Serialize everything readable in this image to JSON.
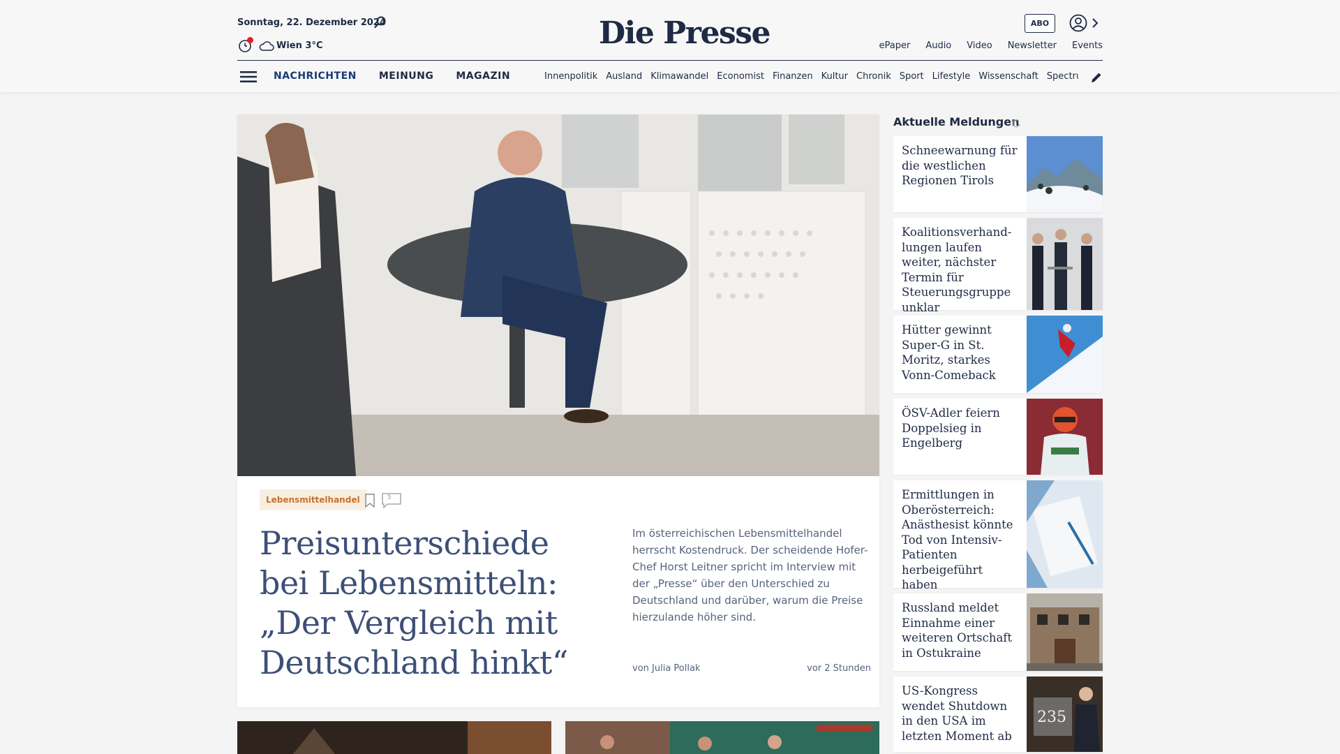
{
  "header": {
    "date": "Sonntag, 22. Dezember 2024",
    "weather": "Wien 3°C",
    "logo": "Die Presse",
    "abo_label": "ABO",
    "top_links": [
      "ePaper",
      "Audio",
      "Video",
      "Newsletter",
      "Events"
    ],
    "main_nav": [
      "NACHRICHTEN",
      "MEINUNG",
      "MAGAZIN"
    ],
    "sub_nav": [
      "Innenpolitik",
      "Ausland",
      "Klimawandel",
      "Economist",
      "Finanzen",
      "Kultur",
      "Chronik",
      "Sport",
      "Lifestyle",
      "Wissenschaft",
      "Spectrum"
    ]
  },
  "hero": {
    "tag": "Lebensmittelhandel",
    "comment_count": "5",
    "headline": "Preisunterschiede bei Lebensmitteln: „Der Vergleich mit Deutschland hinkt“",
    "teaser": "Im österreichischen Lebensmittelhandel herrscht Kostendruck. Der scheidende Hofer-Chef Horst Leitner spricht im Interview mit der „Presse“ über den Unterschied zu Deutschland und darüber, warum die Preise hierzulande höher sind.",
    "author": "von Julia Pollak",
    "ago": "vor 2 Stunden"
  },
  "sidebar": {
    "title": "Aktuelle Meldungen",
    "items": [
      {
        "text": "Schneewarnung für die westlichen Regionen Tirols",
        "thumb": "snow-mountain"
      },
      {
        "text": "Koalitionsverhand­lungen laufen weiter, nächster Termin für Steuerungsgruppe unklar",
        "thumb": "politicians"
      },
      {
        "text": "Hütter gewinnt Super-G in St. Moritz, starkes Vonn-Comeback",
        "thumb": "ski-racer"
      },
      {
        "text": "ÖSV-Adler feiern Doppelsieg in Engelberg",
        "thumb": "ski-jumper"
      },
      {
        "text": "Ermittlungen in Oberösterreich: Anästhesist könnte Tod von Intensiv-Patienten herbeigeführt haben",
        "thumb": "medical"
      },
      {
        "text": "Russland meldet Einnahme einer weiteren Ortschaft in Ostukraine",
        "thumb": "ruined-building"
      },
      {
        "text": "US-Kongress wendet Shutdown in den USA im letzten Moment ab",
        "thumb": "congress"
      }
    ]
  },
  "colors": {
    "brand": "#1f2a44",
    "headline": "#3d4f78",
    "tag_text": "#c9712a",
    "tag_bg": "#f8eee2",
    "notification": "#e11d2a"
  }
}
